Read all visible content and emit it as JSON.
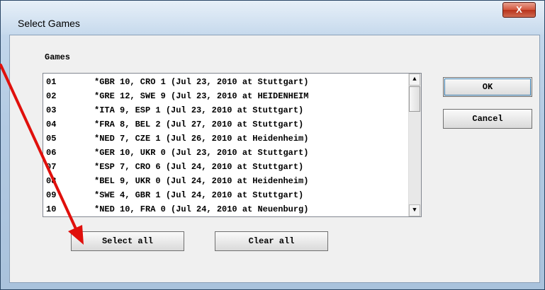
{
  "window": {
    "title": "Select Games",
    "close_glyph": "X"
  },
  "games_label": "Games",
  "games": [
    {
      "num": "01",
      "text": "*GBR 10, CRO 1 (Jul 23, 2010 at Stuttgart)"
    },
    {
      "num": "02",
      "text": "*GRE 12, SWE 9 (Jul 23, 2010 at HEIDENHEIM"
    },
    {
      "num": "03",
      "text": "*ITA 9, ESP 1 (Jul 23, 2010 at Stuttgart)"
    },
    {
      "num": "04",
      "text": "*FRA 8, BEL 2 (Jul 27, 2010 at Stuttgart)"
    },
    {
      "num": "05",
      "text": "*NED 7, CZE 1 (Jul 26, 2010 at Heidenheim)"
    },
    {
      "num": "06",
      "text": "*GER 10, UKR 0 (Jul 23, 2010 at Stuttgart)"
    },
    {
      "num": "07",
      "text": "*ESP 7, CRO 6 (Jul 24, 2010 at Stuttgart)"
    },
    {
      "num": "08",
      "text": "*BEL 9, UKR 0 (Jul 24, 2010 at Heidenheim)"
    },
    {
      "num": "09",
      "text": "*SWE 4, GBR 1 (Jul 24, 2010 at Stuttgart)"
    },
    {
      "num": "10",
      "text": "*NED 10, FRA 0 (Jul 24, 2010 at Neuenburg)"
    }
  ],
  "buttons": {
    "ok": "OK",
    "cancel": "Cancel",
    "select_all": "Select all",
    "clear_all": "Clear all"
  },
  "icons": {
    "scroll_up": "scroll-up-icon",
    "scroll_down": "scroll-down-icon",
    "annotation": "red-arrow-icon"
  },
  "colors": {
    "annotation_arrow": "#e0100c",
    "close_button": "#c8452c"
  }
}
